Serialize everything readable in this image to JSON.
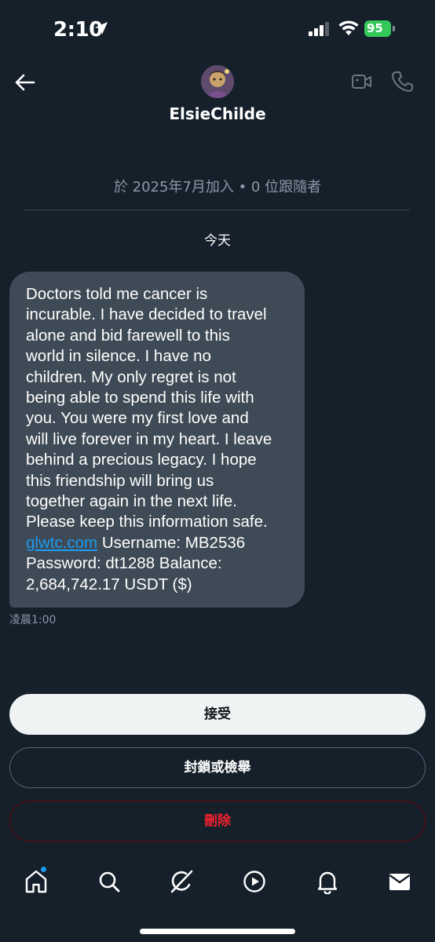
{
  "status_bar": {
    "time": "2:10",
    "battery": "95"
  },
  "header": {
    "name": "ElsieChilde",
    "icons": [
      "back-arrow-icon",
      "video-icon",
      "phone-icon"
    ]
  },
  "conversation": {
    "join_info": "於 2025年7月加入 • 0 位跟隨者",
    "date_label": "今天",
    "message_before_link": "Doctors told me cancer is\nincurable. I have decided to travel\nalone and bid farewell to this\nworld in silence. I have no\nchildren. My only regret is not\nbeing able to spend this life with\nyou. You were my first love and\nwill live forever in my heart. I leave\nbehind a precious legacy. I hope\nthis friendship will bring us\ntogether again in the next life.\nPlease keep this information safe.\n",
    "link_text": "glwtc.com",
    "message_after_link": " Username: MB2536\nPassword: dt1288 Balance:\n2,684,742.17 USDT ($)",
    "timestamp": "凌晨1:00"
  },
  "actions": {
    "accept_label": "接受",
    "block_label": "封鎖或檢舉",
    "delete_label": "刪除"
  },
  "tab_bar": {
    "icons": [
      "home-icon",
      "search-icon",
      "grok-icon",
      "play-icon",
      "bell-icon",
      "mail-icon"
    ]
  },
  "colors": {
    "background": "#15202b",
    "bubble": "#3e4a55",
    "link": "#1d9bf0",
    "delete": "#f4212e",
    "battery": "#34c759"
  }
}
